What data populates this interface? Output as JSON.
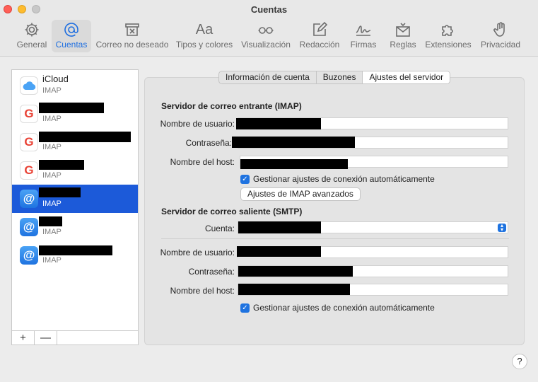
{
  "window": {
    "title": "Cuentas"
  },
  "toolbar": {
    "items": [
      {
        "label": "General",
        "icon": "gear-icon"
      },
      {
        "label": "Cuentas",
        "icon": "at-icon"
      },
      {
        "label": "Correo no deseado",
        "icon": "junk-mail-icon"
      },
      {
        "label": "Tipos y colores",
        "icon": "font-icon",
        "glyph": "Aa"
      },
      {
        "label": "Visualización",
        "icon": "glasses-icon"
      },
      {
        "label": "Redacción",
        "icon": "compose-icon"
      },
      {
        "label": "Firmas",
        "icon": "signature-icon"
      },
      {
        "label": "Reglas",
        "icon": "rules-envelope-icon"
      },
      {
        "label": "Extensiones",
        "icon": "puzzle-icon"
      },
      {
        "label": "Privacidad",
        "icon": "hand-icon"
      }
    ],
    "active": "Cuentas"
  },
  "accounts": [
    {
      "name": "iCloud",
      "type": "IMAP",
      "icon": "icloud-icon"
    },
    {
      "name": "",
      "type": "IMAP",
      "icon": "google-icon",
      "redacted": true
    },
    {
      "name": "",
      "type": "IMAP",
      "icon": "google-icon",
      "redacted": true
    },
    {
      "name": "",
      "type": "IMAP",
      "icon": "google-icon",
      "redacted": true
    },
    {
      "name": "",
      "type": "IMAP",
      "icon": "at-icon",
      "redacted": true,
      "selected": true
    },
    {
      "name": "",
      "type": "IMAP",
      "icon": "at-icon",
      "redacted": true
    },
    {
      "name": "",
      "type": "IMAP",
      "icon": "at-icon",
      "redacted": true
    }
  ],
  "list_footer": {
    "add": "+",
    "remove": "—"
  },
  "tabs": [
    {
      "label": "Información de cuenta"
    },
    {
      "label": "Buzones"
    },
    {
      "label": "Ajustes del servidor",
      "active": true
    }
  ],
  "incoming": {
    "title": "Servidor de correo entrante (IMAP)",
    "username_label": "Nombre de usuario:",
    "password_label": "Contraseña:",
    "host_label": "Nombre del host:",
    "auto_manage_label": "Gestionar ajustes de conexión automáticamente",
    "auto_manage_checked": true,
    "advanced_button": "Ajustes de IMAP avanzados"
  },
  "outgoing": {
    "title": "Servidor de correo saliente (SMTP)",
    "account_label": "Cuenta:",
    "username_label": "Nombre de usuario:",
    "password_label": "Contraseña:",
    "host_label": "Nombre del host:",
    "auto_manage_label": "Gestionar ajustes de conexión automáticamente",
    "auto_manage_checked": true
  },
  "help": {
    "label": "?"
  },
  "colors": {
    "accent": "#1f73e0",
    "selection": "#1c5ad9"
  }
}
